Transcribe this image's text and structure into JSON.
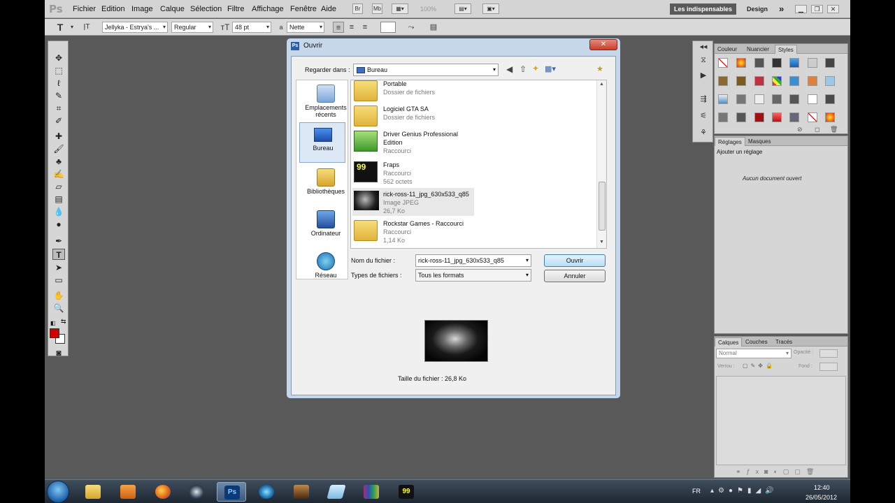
{
  "app": {
    "logo": "Ps",
    "menu": [
      "Fichier",
      "Edition",
      "Image",
      "Calque",
      "Sélection",
      "Filtre",
      "Affichage",
      "Fenêtre",
      "Aide"
    ],
    "menubar_buttons": [
      "Br",
      "Mb"
    ],
    "zoom": "100%",
    "workspace_active": "Les indispensables",
    "workspace_design": "Design",
    "workspace_more": "»"
  },
  "options_bar": {
    "font_family": "Jellyka - Estrya's ...",
    "font_style": "Regular",
    "font_size": "48 pt",
    "aa_label": "a",
    "antialias": "Nette"
  },
  "panels": {
    "top_tabs": [
      "Couleur",
      "Nuancier",
      "Styles"
    ],
    "adjust_tabs": [
      "Réglages",
      "Masques"
    ],
    "adjust_title": "Ajouter un réglage",
    "no_document": "Aucun document ouvert",
    "layers_tabs": [
      "Calques",
      "Couches",
      "Tracés"
    ],
    "blend_mode": "Normal",
    "opacity_label": "Opacité :",
    "lock_label": "Verrou :",
    "fill_label": "Fond :"
  },
  "dialog": {
    "title": "Ouvrir",
    "lookin_label": "Regarder dans :",
    "lookin_value": "Bureau",
    "places": [
      {
        "label": "Emplacements récents"
      },
      {
        "label": "Bureau"
      },
      {
        "label": "Bibliothèques"
      },
      {
        "label": "Ordinateur"
      },
      {
        "label": "Réseau"
      }
    ],
    "files": [
      {
        "name": "Portable",
        "sub1": "Dossier de fichiers",
        "sub2": ""
      },
      {
        "name": "Logiciel GTA SA",
        "sub1": "Dossier de fichiers",
        "sub2": ""
      },
      {
        "name": "Driver Genius Professional Edition",
        "sub1": "Raccourci",
        "sub2": ""
      },
      {
        "name": "Fraps",
        "sub1": "Raccourci",
        "sub2": "562 octets"
      },
      {
        "name": "rick-ross-11_jpg_630x533_q85",
        "sub1": "Image JPEG",
        "sub2": "26,7 Ko"
      },
      {
        "name": "Rockstar Games - Raccourci",
        "sub1": "Raccourci",
        "sub2": "1,14 Ko"
      }
    ],
    "filename_label": "Nom du fichier :",
    "filename_value": "rick-ross-11_jpg_630x533_q85",
    "filetype_label": "Types de fichiers :",
    "filetype_value": "Tous les formats",
    "open_button": "Ouvrir",
    "cancel_button": "Annuler",
    "filesize": "Taille du fichier : 26,8 Ko"
  },
  "taskbar": {
    "lang": "FR",
    "time": "12:40",
    "date": "26/05/2012"
  }
}
